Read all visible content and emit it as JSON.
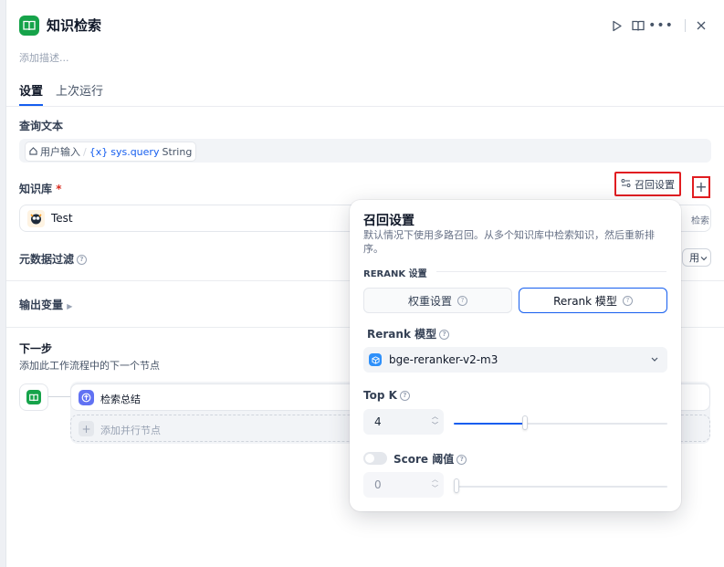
{
  "header": {
    "title": "知识检索",
    "description_placeholder": "添加描述...",
    "icons": [
      "play-icon",
      "book-open-icon",
      "more-icon",
      "close-icon"
    ]
  },
  "tabs": [
    {
      "label": "设置",
      "active": true
    },
    {
      "label": "上次运行",
      "active": false
    }
  ],
  "query": {
    "label": "查询文本",
    "source": "用户输入",
    "var_name": "sys.query",
    "var_type": "String"
  },
  "knowledge": {
    "label": "知识库",
    "required_mark": "*",
    "recall_button": "召回设置",
    "add_button": "+",
    "item_name": "Test",
    "item_action": "检索"
  },
  "metadata": {
    "label": "元数据过滤",
    "select_value": "用"
  },
  "output": {
    "label": "输出变量"
  },
  "next": {
    "label": "下一步",
    "description": "添加此工作流程中的下一个节点",
    "node_label": "检索总结",
    "add_parallel": "添加并行节点"
  },
  "popup": {
    "title": "召回设置",
    "description": "默认情况下使用多路召回。从多个知识库中检索知识，然后重新排序。",
    "section": "RERANK 设置",
    "tab_weight": "权重设置",
    "tab_rerank": "Rerank 模型",
    "rerank_label": "Rerank 模型",
    "model_value": "bge-reranker-v2-m3",
    "topk_label": "Top K",
    "topk_value": "4",
    "topk_fraction": 0.335,
    "score_label": "Score 阈值",
    "score_value": "0",
    "score_enabled": false
  },
  "colors": {
    "accent": "#155eef",
    "brand_green": "#16a34a",
    "highlight_red": "#e11d21"
  }
}
